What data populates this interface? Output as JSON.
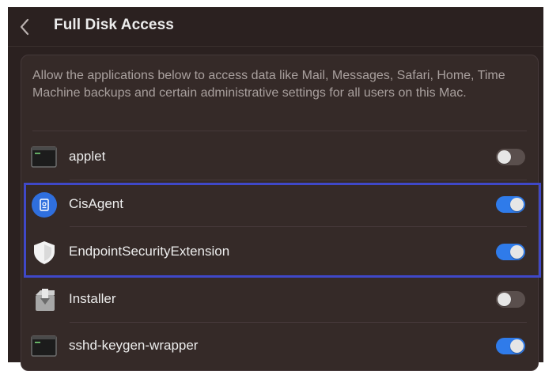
{
  "header": {
    "title": "Full Disk Access"
  },
  "description": "Allow the applications below to access data like Mail, Messages, Safari, Home, Time Machine backups and certain administrative settings for all users on this Mac.",
  "apps": [
    {
      "name": "applet",
      "icon": "terminal-icon",
      "enabled": false
    },
    {
      "name": "CisAgent",
      "icon": "cisagent-icon",
      "enabled": true
    },
    {
      "name": "EndpointSecurityExtension",
      "icon": "shield-icon",
      "enabled": true
    },
    {
      "name": "Installer",
      "icon": "installer-icon",
      "enabled": false
    },
    {
      "name": "sshd-keygen-wrapper",
      "icon": "terminal-icon",
      "enabled": true
    }
  ],
  "colors": {
    "background": "#2b2120",
    "panel": "#352a28",
    "toggle_on": "#2f7bea",
    "toggle_off": "#5a4f4d",
    "highlight": "#3f48c8"
  }
}
